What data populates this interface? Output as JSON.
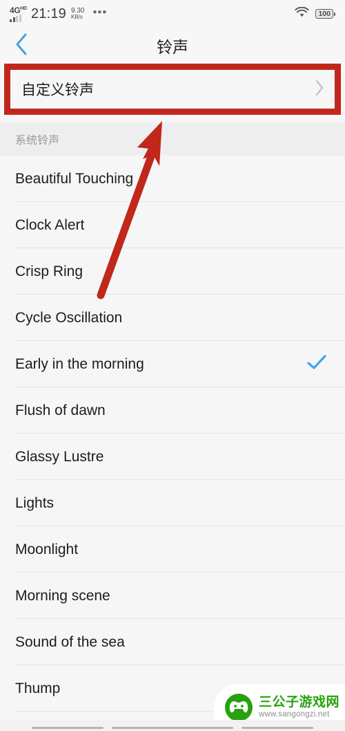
{
  "status_bar": {
    "network_type": "4G",
    "network_suffix": "HD",
    "time": "21:19",
    "speed_value": "9.30",
    "speed_unit": "KB/s",
    "overflow_dots": "•••",
    "wifi_icon": "wifi-icon",
    "battery_level": "100"
  },
  "header": {
    "back_icon": "chevron-left-icon",
    "title": "铃声"
  },
  "custom_ringtone": {
    "label": "自定义铃声",
    "chevron_icon": "chevron-right-icon",
    "highlight_color": "#c1271b"
  },
  "section": {
    "title": "系统铃声"
  },
  "ringtones": [
    {
      "name": "Beautiful Touching",
      "selected": false
    },
    {
      "name": "Clock Alert",
      "selected": false
    },
    {
      "name": "Crisp Ring",
      "selected": false
    },
    {
      "name": "Cycle Oscillation",
      "selected": false
    },
    {
      "name": "Early in the morning",
      "selected": true
    },
    {
      "name": "Flush of dawn",
      "selected": false
    },
    {
      "name": "Glassy Lustre",
      "selected": false
    },
    {
      "name": "Lights",
      "selected": false
    },
    {
      "name": "Moonlight",
      "selected": false
    },
    {
      "name": "Morning scene",
      "selected": false
    },
    {
      "name": "Sound of the sea",
      "selected": false
    },
    {
      "name": "Thump",
      "selected": false
    }
  ],
  "selection": {
    "check_icon": "check-icon",
    "check_color": "#3ba7e8"
  },
  "annotation": {
    "arrow_color": "#c1271b",
    "arrow_description": "red-arrow-pointing-to-custom-ringtone"
  },
  "watermark": {
    "site_name": "三公子游戏网",
    "url": "www.sangongzi.net",
    "logo_icon": "game-controller-mascot-icon",
    "brand_color": "#27a10e"
  },
  "nav_bar": {
    "back_label": "nav-back",
    "home_label": "nav-home",
    "recent_label": "nav-recent"
  }
}
